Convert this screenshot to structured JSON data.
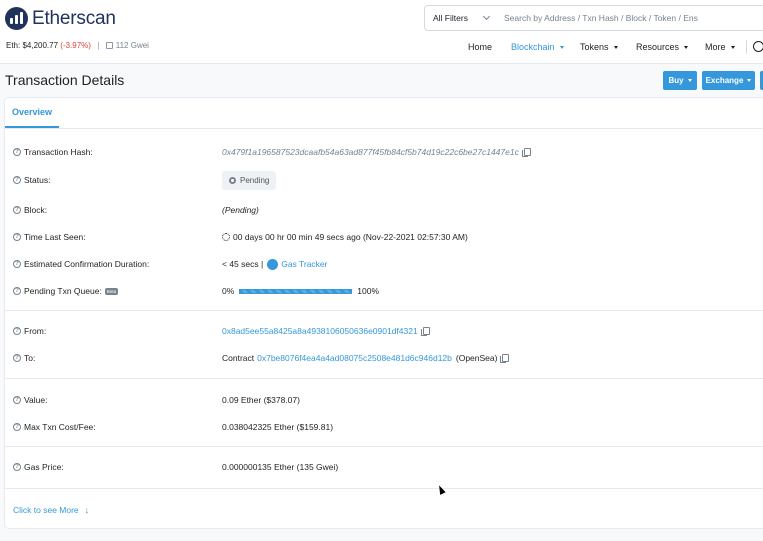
{
  "header": {
    "logo_text": "Etherscan",
    "eth_label": "Eth: $4,200.77",
    "eth_change": "(-3.97%)",
    "separator": "|",
    "gas_value": "112 Gwei"
  },
  "search": {
    "filter_label": "All Filters",
    "placeholder": "Search by Address / Txn Hash / Block / Token / Ens"
  },
  "nav": {
    "home": "Home",
    "blockchain": "Blockchain",
    "tokens": "Tokens",
    "resources": "Resources",
    "more": "More"
  },
  "page": {
    "title": "Transaction Details",
    "buy_label": "Buy",
    "exchange_label": "Exchange"
  },
  "tabs": {
    "overview": "Overview"
  },
  "fields": {
    "tx_hash": {
      "label": "Transaction Hash:",
      "value": "0x479f1a196587523dcaafb54a63ad877f45fb84cf5b74d19c22c6be27c1447e1c"
    },
    "status": {
      "label": "Status:",
      "value": "Pending"
    },
    "block": {
      "label": "Block:",
      "value": "(Pending)"
    },
    "time_last_seen": {
      "label": "Time Last Seen:",
      "value": "00 days 00 hr 00 min 49 secs ago (Nov-22-2021 02:57:30 AM)"
    },
    "confirmation": {
      "label": "Estimated Confirmation Duration:",
      "value": "< 45 secs |",
      "link": "Gas Tracker"
    },
    "queue": {
      "label": "Pending Txn Queue:",
      "beta": "Beta",
      "start": "0%",
      "end": "100%",
      "progress": 1.0
    },
    "from": {
      "label": "From:",
      "value": "0x8ad5ee55a8425a8a4938106050636e0901df4321"
    },
    "to": {
      "label": "To:",
      "prefix": "Contract",
      "value": "0x7be8076f4ea4a4ad08075c2508e481d6c946d12b",
      "suffix": "(OpenSea)"
    },
    "value": {
      "label": "Value:",
      "value": "0.09 Ether ($378.07)"
    },
    "max_fee": {
      "label": "Max Txn Cost/Fee:",
      "value": "0.038042325 Ether ($159.81)"
    },
    "gas_price": {
      "label": "Gas Price:",
      "value": "0.000000135 Ether (135 Gwei)"
    }
  },
  "footer": {
    "see_more": "Click to see More",
    "arrow": "↓"
  },
  "colors": {
    "accent": "#3498db",
    "negative": "#de4437",
    "brand": "#21325b"
  }
}
